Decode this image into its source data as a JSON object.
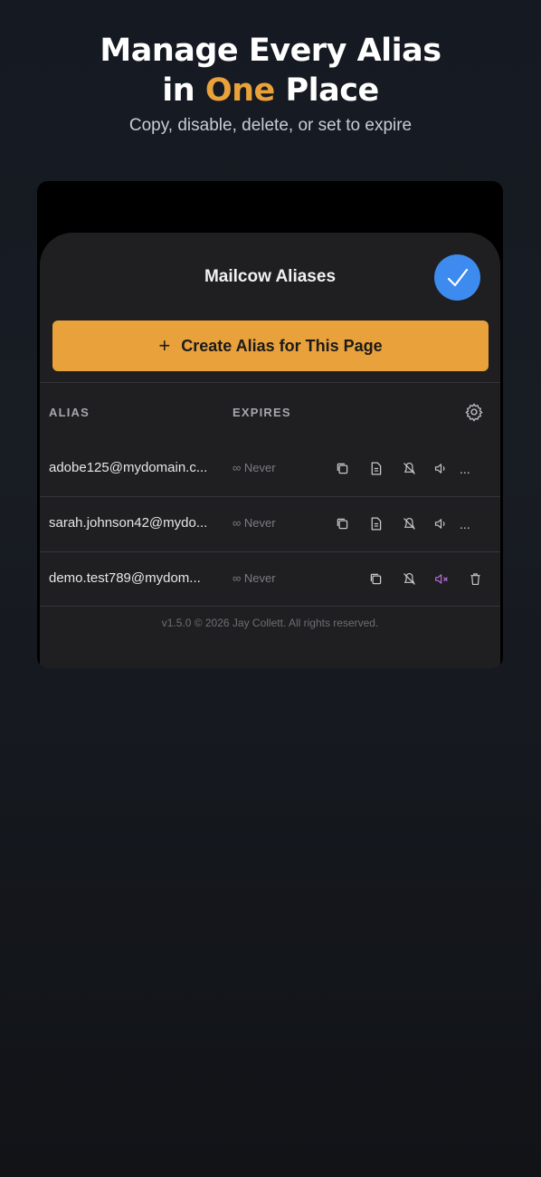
{
  "hero": {
    "line1": "Manage Every Alias",
    "line2_prefix": "in ",
    "line2_accent": "One",
    "line2_suffix": " Place",
    "subtitle": "Copy, disable, delete, or set to expire"
  },
  "colors": {
    "accent": "#e9a13b",
    "check": "#3d8bef",
    "muted_purple": "#b76de0",
    "background": "#181c23",
    "panel": "#1f1f21"
  },
  "panel": {
    "title": "Mailcow Aliases",
    "check_icon": "checkmark-icon",
    "create_button": {
      "plus": "+",
      "label": "Create Alias for This Page"
    },
    "columns": {
      "alias": "ALIAS",
      "expires": "EXPIRES"
    },
    "settings_icon": "gear-icon",
    "rows": [
      {
        "alias": "adobe125@mydomain.c...",
        "expires": "∞ Never",
        "actions": [
          "copy-icon",
          "note-icon",
          "disable-icon",
          "speaker-icon",
          "more-icon"
        ],
        "more": "..."
      },
      {
        "alias": "sarah.johnson42@mydo...",
        "expires": "∞ Never",
        "actions": [
          "copy-icon",
          "note-icon",
          "disable-icon",
          "speaker-icon",
          "more-icon"
        ],
        "more": "..."
      },
      {
        "alias": "demo.test789@mydom...",
        "expires": "∞ Never",
        "actions": [
          "copy-icon",
          "disable-icon",
          "mute-icon",
          "trash-icon"
        ]
      }
    ],
    "footer": "v1.5.0 © 2026 Jay Collett. All rights reserved."
  }
}
